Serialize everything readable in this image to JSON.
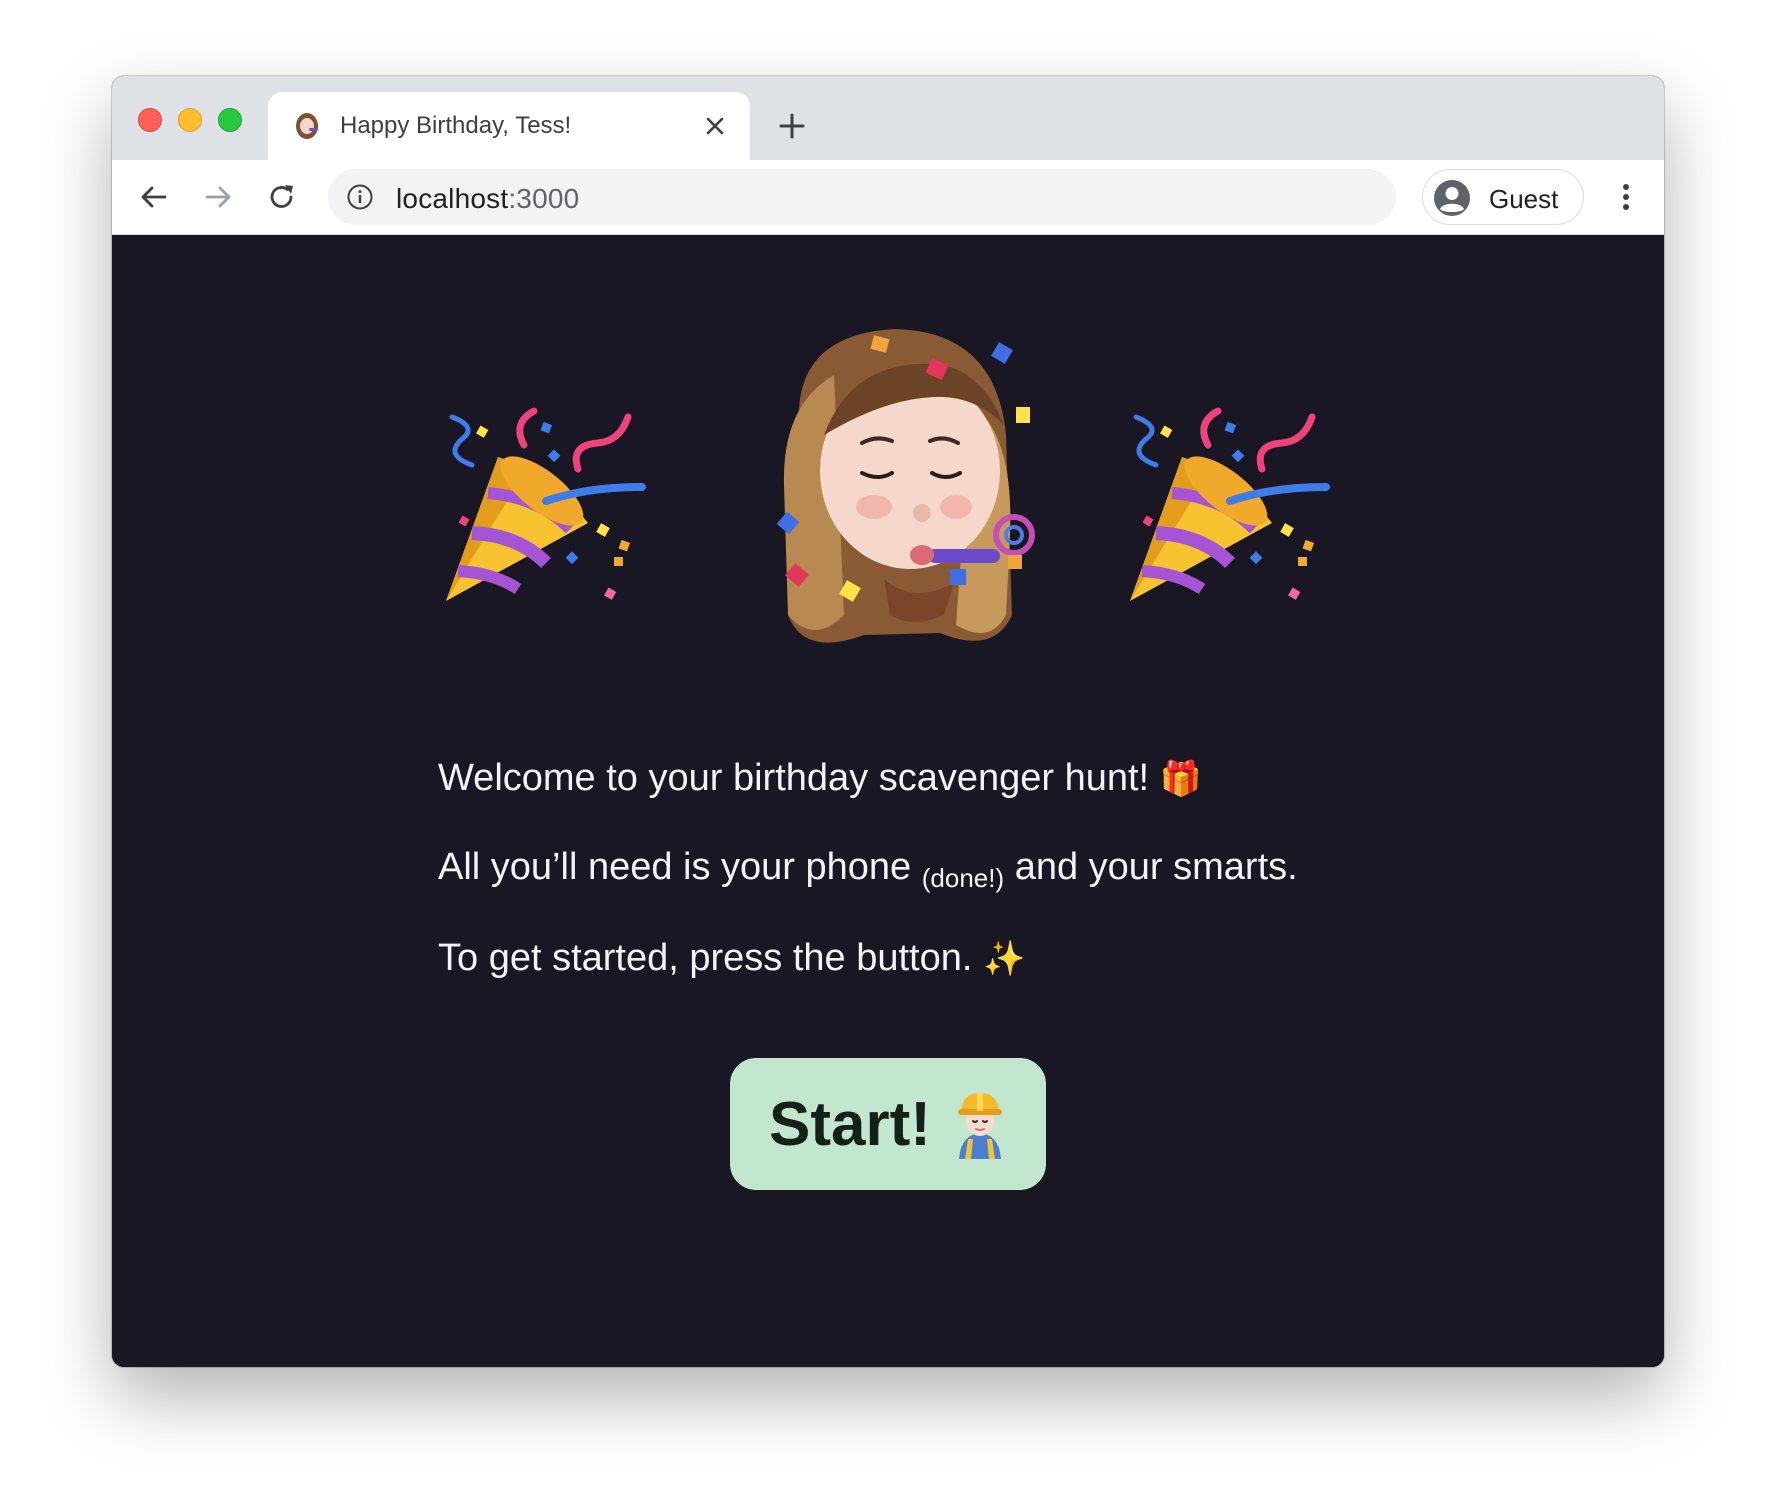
{
  "browser": {
    "tab": {
      "title": "Happy Birthday, Tess!",
      "close_icon": "close-icon",
      "favicon": "memoji-favicon-icon"
    },
    "new_tab_icon": "plus-icon",
    "nav": {
      "back_icon": "arrow-left-icon",
      "forward_icon": "arrow-right-icon",
      "reload_icon": "reload-icon"
    },
    "address": {
      "info_icon": "info-icon",
      "host": "localhost",
      "port": ":3000"
    },
    "profile": {
      "label": "Guest",
      "avatar_icon": "person-circle-icon"
    },
    "menu_icon": "more-vertical-icon"
  },
  "page": {
    "hero_icons": [
      "party-popper-icon",
      "memoji-party-icon",
      "party-popper-icon"
    ],
    "welcome_text": "Welcome to your birthday scavenger hunt!",
    "welcome_emoji": "🎁",
    "need_text_before": "All you’ll need is your phone",
    "need_text_small": "(done!)",
    "need_text_after": "and your smarts.",
    "start_text": "To get started, press the button.",
    "start_emoji": "✨",
    "button_label": "Start!",
    "button_icon": "construction-worker-icon",
    "colors": {
      "background": "#191724",
      "text": "#f4f3f8",
      "button": "#c3e6cf",
      "button_text": "#152019"
    }
  }
}
